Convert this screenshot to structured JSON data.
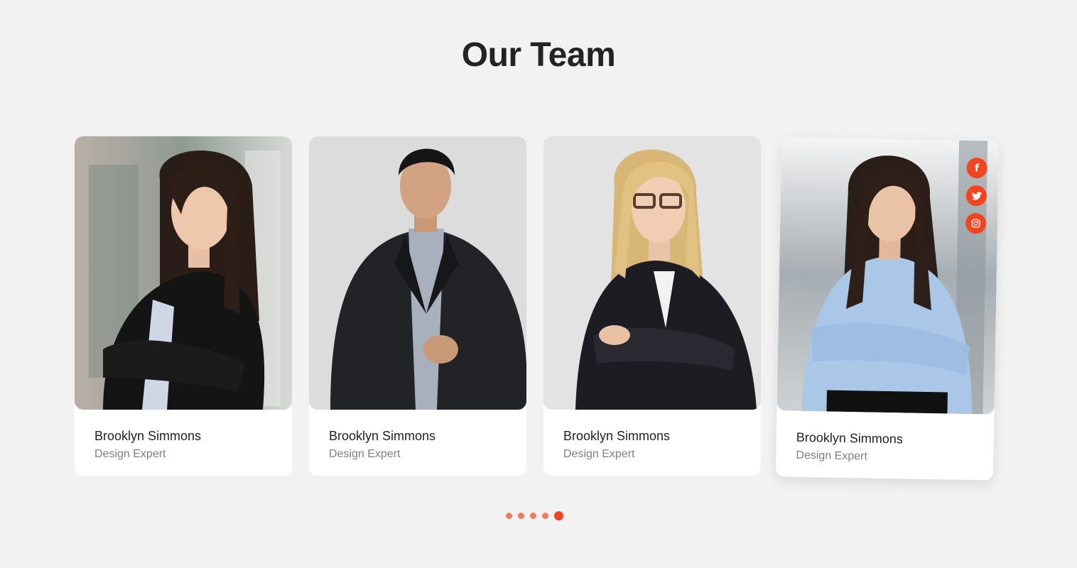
{
  "section": {
    "title": "Our Team"
  },
  "members": [
    {
      "name": "Brooklyn Simmons",
      "role": "Design Expert"
    },
    {
      "name": "Brooklyn Simmons",
      "role": "Design Expert"
    },
    {
      "name": "Brooklyn Simmons",
      "role": "Design Expert"
    },
    {
      "name": "Brooklyn Simmons",
      "role": "Design Expert"
    }
  ],
  "socials": [
    {
      "icon": "facebook-icon",
      "glyph": "f"
    },
    {
      "icon": "twitter-icon",
      "glyph": "🐦"
    },
    {
      "icon": "instagram-icon",
      "glyph": "◎"
    }
  ],
  "pagination": {
    "total": 5,
    "current": 5
  },
  "colors": {
    "accent": "#f4431f",
    "accent_light": "#f07a5d",
    "background": "#f2f2f2",
    "title": "#232323"
  }
}
